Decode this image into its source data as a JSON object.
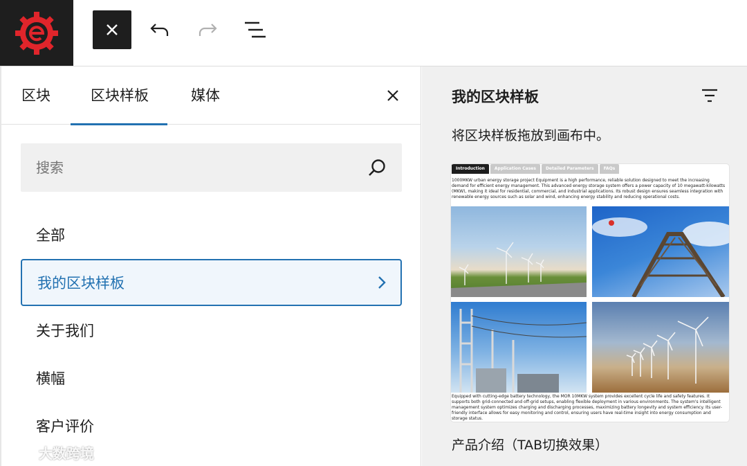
{
  "toolbar": {
    "close_label": "close",
    "undo_label": "undo",
    "redo_label": "redo",
    "outline_label": "document overview"
  },
  "inserter": {
    "tabs": [
      {
        "label": "区块"
      },
      {
        "label": "区块样板"
      },
      {
        "label": "媒体"
      }
    ],
    "active_tab": 1,
    "search": {
      "placeholder": "搜索",
      "value": ""
    },
    "categories": [
      {
        "label": "全部"
      },
      {
        "label": "我的区块样板"
      },
      {
        "label": "关于我们"
      },
      {
        "label": "横幅"
      },
      {
        "label": "客户评价"
      }
    ],
    "selected_category": 1
  },
  "preview": {
    "title": "我的区块样板",
    "hint": "将区块样板拖放到画布中。",
    "pattern": {
      "tabs": [
        "Introduction",
        "Application Cases",
        "Detailed Parameters",
        "FAQs"
      ],
      "intro_text": "1000MKW urban energy storage project Equipment is a high performance, reliable solution designed to meet the increasing demand for efficient energy management. This advanced energy storage system offers a power capacity of 10 megawatt-kilowatts (MKW), making it ideal for residential, commercial, and industrial applications. Its robust design ensures seamless integration with renewable energy sources such as solar and wind, enhancing energy stability and reducing operational costs.",
      "outro_text": "Equipped with cutting-edge battery technology, the MOR 10MKW system provides excellent cycle life and safety features. It supports both grid-connected and off-grid setups, enabling flexible deployment in various environments. The system's intelligent management system optimizes charging and discharging processes, maximizing battery longevity and system efficiency. Its user-friendly interface allows for easy monitoring and control, ensuring users have real-time insight into energy consumption and storage status."
    },
    "next_pattern_title": "产品介绍（TAB切换效果）"
  },
  "watermark": {
    "text": "大数跨境"
  },
  "colors": {
    "accent": "#2271b1",
    "dark": "#1e1e1e",
    "logo_red": "#e0252b"
  }
}
